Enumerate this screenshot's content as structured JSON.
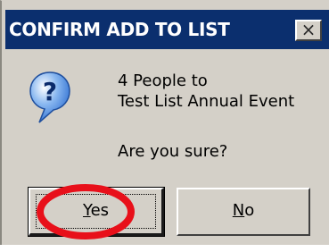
{
  "dialog": {
    "title": "CONFIRM ADD TO LIST",
    "close_glyph": "×",
    "icon": "question-icon",
    "message_line1": "4 People to",
    "message_line2": "Test List Annual Event",
    "confirm_text": "Are you sure?",
    "yes_mnemonic": "Y",
    "yes_rest": "es",
    "no_mnemonic": "N",
    "no_rest": "o"
  },
  "colors": {
    "titlebar": "#0b2f6e",
    "face": "#d4d0c8",
    "highlight_ring": "#e8101a",
    "icon_blue": "#2e6fd1"
  }
}
